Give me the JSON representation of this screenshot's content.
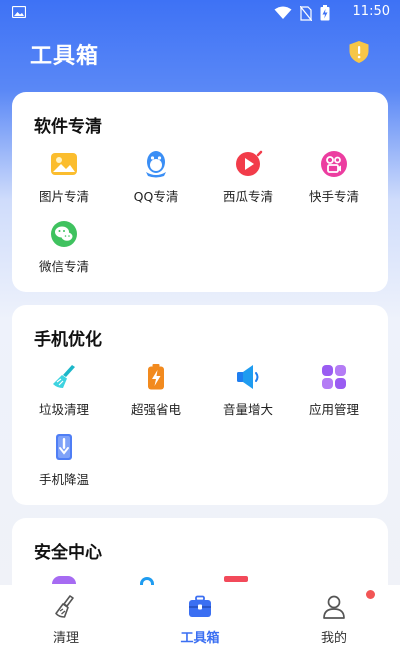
{
  "status_bar": {
    "time": "11:50"
  },
  "header": {
    "title": "工具箱"
  },
  "sections": [
    {
      "title": "软件专清",
      "items": [
        {
          "label": "图片专清",
          "icon": "picture-icon"
        },
        {
          "label": "QQ专清",
          "icon": "qq-penguin-icon"
        },
        {
          "label": "西瓜专清",
          "icon": "xigua-play-icon"
        },
        {
          "label": "快手专清",
          "icon": "kuaishou-icon"
        },
        {
          "label": "微信专清",
          "icon": "wechat-icon"
        }
      ]
    },
    {
      "title": "手机优化",
      "items": [
        {
          "label": "垃圾清理",
          "icon": "broom-icon"
        },
        {
          "label": "超强省电",
          "icon": "battery-bolt-icon"
        },
        {
          "label": "音量增大",
          "icon": "speaker-icon"
        },
        {
          "label": "应用管理",
          "icon": "apps-grid-icon"
        },
        {
          "label": "手机降温",
          "icon": "thermometer-icon"
        }
      ]
    },
    {
      "title": "安全中心",
      "items": []
    }
  ],
  "bottom_nav": [
    {
      "label": "清理",
      "icon": "broom-nav-icon",
      "active": false
    },
    {
      "label": "工具箱",
      "icon": "toolbox-icon",
      "active": true
    },
    {
      "label": "我的",
      "icon": "person-icon",
      "active": false
    }
  ],
  "colors": {
    "brand_blue": "#3b6ff2",
    "badge_red": "#f25555"
  }
}
